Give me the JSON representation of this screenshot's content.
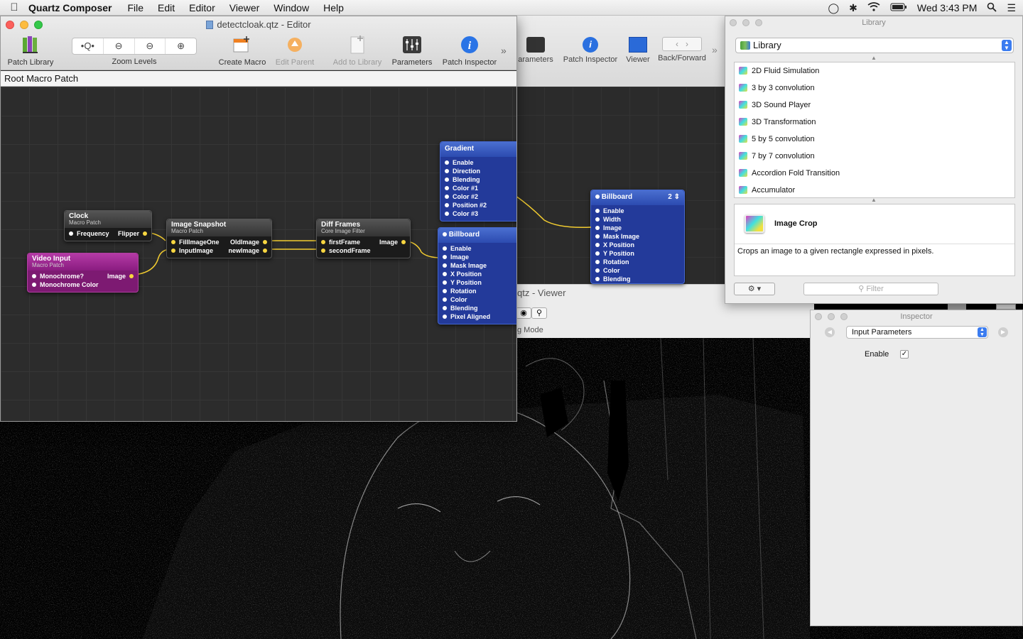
{
  "menubar": {
    "app_name": "Quartz Composer",
    "menus": [
      "File",
      "Edit",
      "Editor",
      "Viewer",
      "Window",
      "Help"
    ],
    "clock": "Wed 3:43 PM"
  },
  "editor": {
    "title": "detectcloak.qtz - Editor",
    "toolbar": {
      "patch_library": "Patch Library",
      "zoom_levels": "Zoom Levels",
      "create_macro": "Create Macro",
      "edit_parent": "Edit Parent",
      "add_to_library": "Add to Library",
      "parameters": "Parameters",
      "patch_inspector": "Patch Inspector"
    },
    "breadcrumb": "Root Macro Patch",
    "patches": {
      "clock": {
        "title": "Clock",
        "subtitle": "Macro Patch",
        "in": "Frequency",
        "out": "Flipper"
      },
      "video_input": {
        "title": "Video Input",
        "subtitle": "Macro Patch",
        "in1": "Monochrome?",
        "out": "Image",
        "in2": "Monochrome Color"
      },
      "image_snapshot": {
        "title": "Image Snapshot",
        "subtitle": "Macro Patch",
        "in1": "FillImageOne",
        "out1": "OldImage",
        "in2": "InputImage",
        "out2": "newImage"
      },
      "diff_frames": {
        "title": "Diff Frames",
        "subtitle": "Core Image Filter",
        "in1": "firstFrame",
        "out": "Image",
        "in2": "secondFrame"
      },
      "gradient": {
        "title": "Gradient",
        "ports": [
          "Enable",
          "Direction",
          "Blending",
          "Color #1",
          "Color #2",
          "Position #2",
          "Color #3"
        ]
      },
      "billboard1": {
        "title": "Billboard",
        "ports": [
          "Enable",
          "Image",
          "Mask Image",
          "X Position",
          "Y Position",
          "Rotation",
          "Color",
          "Blending",
          "Pixel Aligned"
        ]
      },
      "billboard2": {
        "title": "Billboard",
        "badge": "2",
        "ports": [
          "Enable",
          "Width",
          "Image",
          "Mask Image",
          "X Position",
          "Y Position",
          "Rotation",
          "Color",
          "Blending"
        ]
      }
    }
  },
  "viewer": {
    "toolbar": {
      "parameters": "arameters",
      "patch_inspector": "Patch Inspector",
      "viewer": "Viewer",
      "back_forward": "Back/Forward"
    },
    "title": "qtz - Viewer",
    "mode": "g Mode"
  },
  "library": {
    "window_title": "Library",
    "select": "Library",
    "items": [
      "2D Fluid Simulation",
      "3 by 3 convolution",
      "3D Sound Player",
      "3D Transformation",
      "5 by 5 convolution",
      "7 by 7 convolution",
      "Accordion Fold Transition",
      "Accumulator"
    ],
    "detail_name": "Image Crop",
    "detail_desc": "Crops an image to a given rectangle expressed in pixels.",
    "filter_placeholder": "Filter"
  },
  "inspector": {
    "window_title": "Inspector",
    "select": "Input Parameters",
    "enable_label": "Enable",
    "enable_checked": "✓"
  }
}
